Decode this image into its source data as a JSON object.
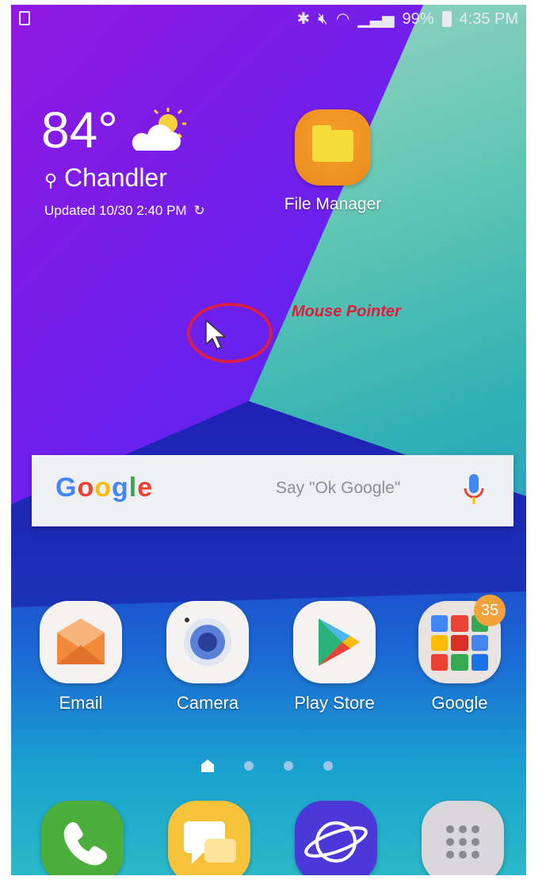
{
  "status_bar": {
    "left_icon": "sim-card-icon",
    "icons": [
      "bluetooth-icon",
      "mute-icon",
      "wifi-icon",
      "signal-icon"
    ],
    "battery": "99%",
    "time": "4:35 PM"
  },
  "weather": {
    "temperature": "84°",
    "location": "Chandler",
    "updated": "Updated 10/30 2:40 PM",
    "icon": "partly-sunny-icon"
  },
  "desktop": {
    "file_manager": {
      "label": "File Manager",
      "icon": "folder-icon"
    }
  },
  "annotation": {
    "label": "Mouse Pointer",
    "color": "#e01b3c"
  },
  "search": {
    "logo": "Google",
    "hint": "Say \"Ok Google\"",
    "icon": "mic-icon"
  },
  "apps": [
    {
      "label": "Email",
      "icon": "email-icon"
    },
    {
      "label": "Camera",
      "icon": "camera-icon"
    },
    {
      "label": "Play Store",
      "icon": "play-store-icon"
    },
    {
      "label": "Google",
      "icon": "google-folder-icon",
      "badge": "35"
    }
  ],
  "page_indicator": {
    "pages": 4,
    "current": 1
  },
  "dock": [
    {
      "icon": "phone-icon"
    },
    {
      "icon": "messages-icon"
    },
    {
      "icon": "internet-icon"
    },
    {
      "icon": "apps-icon"
    }
  ]
}
